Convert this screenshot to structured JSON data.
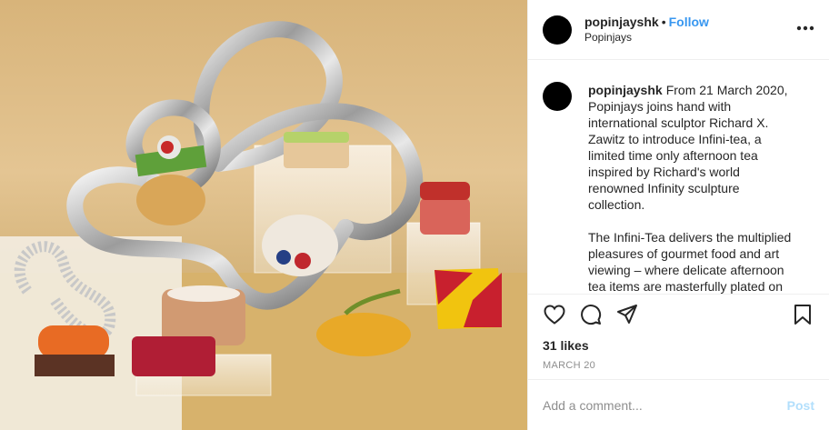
{
  "post": {
    "image_alt": "Infini-tea afternoon tea set on a chrome infinity sculpture"
  },
  "header": {
    "username": "popinjayshk",
    "separator": "•",
    "follow_label": "Follow",
    "location": "Popinjays",
    "more_icon": "more-options-icon"
  },
  "caption": {
    "username": "popinjayshk",
    "paragraph1": "From 21 March 2020, Popinjays joins hand with international sculptor Richard X. Zawitz to introduce Infini-tea, a limited time only afternoon tea inspired by Richard's world renowned Infinity sculpture collection.",
    "paragraph2": "The Infini-Tea delivers the multiplied pleasures of gourmet food and art viewing – where delicate afternoon tea items are masterfully plated on Richard's celebrated sculpture pieces."
  },
  "actions": {
    "icons": [
      "heart-icon",
      "comment-icon",
      "share-icon",
      "bookmark-icon"
    ]
  },
  "likes": "31 likes",
  "date": "MARCH 20",
  "comment": {
    "placeholder": "Add a comment...",
    "post_label": "Post"
  },
  "colors": {
    "link": "#3897f0",
    "post_disabled": "#b2dffc",
    "muted": "#8e8e8e",
    "border": "#efefef"
  }
}
